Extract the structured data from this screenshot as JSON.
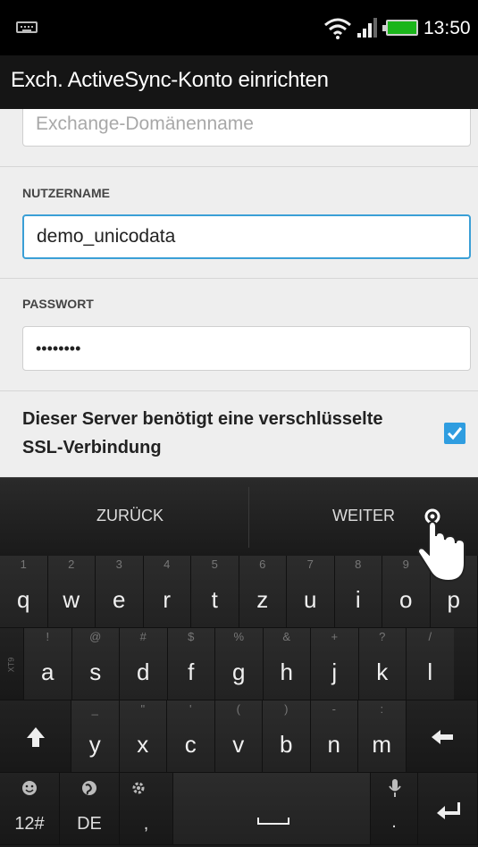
{
  "status": {
    "time": "13:50"
  },
  "titlebar": {
    "title": "Exch. ActiveSync-Konto einrichten"
  },
  "form": {
    "domain_placeholder": "Exchange-Domänenname",
    "username_label": "NUTZERNAME",
    "username_value": "demo_unicodata",
    "password_label": "PASSWORT",
    "password_value": "••••••••",
    "ssl_text": "Dieser Server benötigt eine verschlüsselte SSL-Verbindung",
    "ssl_checked": true
  },
  "actions": {
    "back_label": "ZURÜCK",
    "next_label": "WEITER"
  },
  "keyboard": {
    "row1": [
      {
        "alt": "1",
        "main": "q"
      },
      {
        "alt": "2",
        "main": "w"
      },
      {
        "alt": "3",
        "main": "e"
      },
      {
        "alt": "4",
        "main": "r"
      },
      {
        "alt": "5",
        "main": "t"
      },
      {
        "alt": "6",
        "main": "z"
      },
      {
        "alt": "7",
        "main": "u"
      },
      {
        "alt": "8",
        "main": "i"
      },
      {
        "alt": "9",
        "main": "o"
      },
      {
        "alt": "0",
        "main": "p"
      }
    ],
    "row2": [
      {
        "alt": "!",
        "main": "a"
      },
      {
        "alt": "@",
        "main": "s"
      },
      {
        "alt": "#",
        "main": "d"
      },
      {
        "alt": "$",
        "main": "f"
      },
      {
        "alt": "%",
        "main": "g"
      },
      {
        "alt": "&",
        "main": "h"
      },
      {
        "alt": "+",
        "main": "j"
      },
      {
        "alt": "?",
        "main": "k"
      },
      {
        "alt": "/",
        "main": "l"
      }
    ],
    "row3": [
      {
        "alt": "_",
        "main": "y"
      },
      {
        "alt": "\"",
        "main": "x"
      },
      {
        "alt": "'",
        "main": "c"
      },
      {
        "alt": "(",
        "main": "v"
      },
      {
        "alt": ")",
        "main": "b"
      },
      {
        "alt": "-",
        "main": "n"
      },
      {
        "alt": ":",
        "main": "m"
      }
    ],
    "row4": {
      "symbols_label": "12#",
      "language_label": "DE",
      "comma_label": ",",
      "period_label": "."
    },
    "side_label": "XT9"
  },
  "colors": {
    "accent": "#2f9de0",
    "battery": "#1bb51b"
  }
}
